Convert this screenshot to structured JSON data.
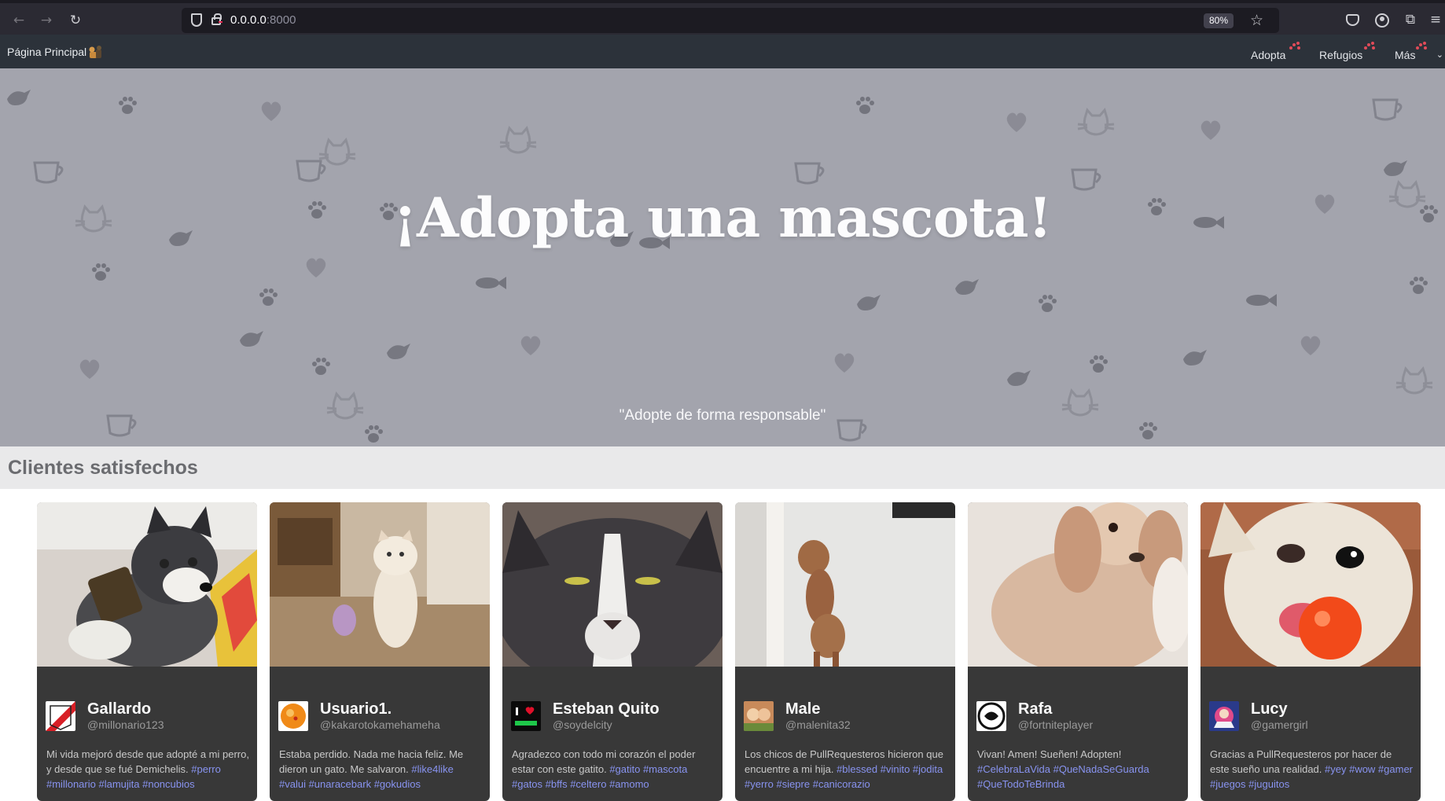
{
  "browser": {
    "url_host": "0.0.0.0",
    "url_port": ":8000",
    "zoom": "80%"
  },
  "navbar": {
    "brand": "Página Principal",
    "links": [
      {
        "label": "Adopta"
      },
      {
        "label": "Refugios"
      },
      {
        "label": "Más"
      }
    ]
  },
  "hero": {
    "title": "¡Adopta una mascota!",
    "subtitle": "\"Adopte de forma responsable\""
  },
  "section": {
    "title": "Clientes satisfechos"
  },
  "cards": [
    {
      "name": "Gallardo",
      "handle": "@millonario123",
      "text": "Mi vida mejoró desde que adopté a mi perro, y desde que se fué Demichelis.",
      "tags": "#perro",
      "tags2": "#millonario #lamujita #noncubios"
    },
    {
      "name": "Usuario1.",
      "handle": "@kakarotokamehameha",
      "text": "Estaba perdido. Nada me hacia feliz. Me dieron un gato. Me salvaron.",
      "tags": "#like4like",
      "tags2": "#valui #unaracebark #gokudios"
    },
    {
      "name": "Esteban Quito",
      "handle": "@soydelcity",
      "text": "Agradezco con todo mi corazón el poder estar con este gatito.",
      "tags": "#gatito #mascota",
      "tags2": "#gatos #bffs #celtero #amomo"
    },
    {
      "name": "Male",
      "handle": "@malenita32",
      "text": "Los chicos de PullRequesteros hicieron que encuentre a mi hija.",
      "tags": "#blessed #vinito #jodita",
      "tags2": "#yerro #siepre #canicorazio"
    },
    {
      "name": "Rafa",
      "handle": "@fortniteplayer",
      "text": "Vivan! Amen! Sueñen! Adopten!",
      "tags": "#CelebraLaVida #QueNadaSeGuarda",
      "tags2": "#QueTodoTeBrinda"
    },
    {
      "name": "Lucy",
      "handle": "@gamergirl",
      "text": "Gracias a PullRequesteros por hacer de este sueño una realidad.",
      "tags": "#yey #wow #gamer",
      "tags2": "#juegos #juguitos"
    }
  ],
  "colors": {
    "hero_bg": "#a3a4ad",
    "navbar_bg": "#2c323a",
    "card_bg": "#383838",
    "hashtag": "#8893f0"
  }
}
